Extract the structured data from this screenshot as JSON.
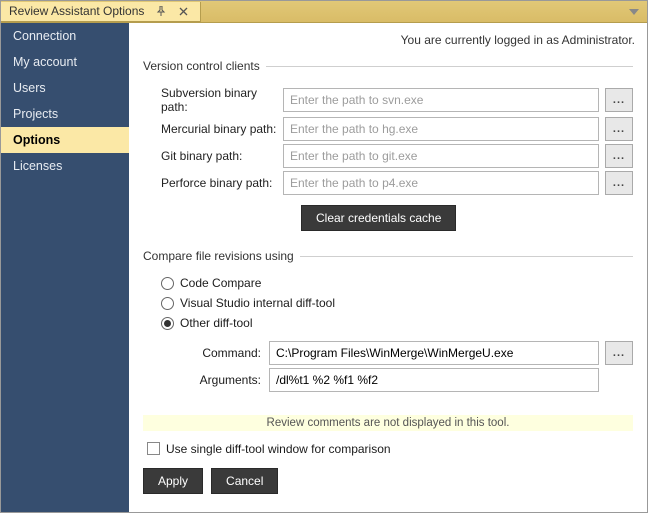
{
  "window": {
    "title": "Review Assistant Options"
  },
  "sidebar": {
    "items": [
      {
        "label": "Connection"
      },
      {
        "label": "My account"
      },
      {
        "label": "Users"
      },
      {
        "label": "Projects"
      },
      {
        "label": "Options"
      },
      {
        "label": "Licenses"
      }
    ],
    "activeIndex": 4
  },
  "status": {
    "text": "You are currently logged in as Administrator."
  },
  "vcs": {
    "legend": "Version control clients",
    "svn": {
      "label": "Subversion binary path:",
      "placeholder": "Enter the path to svn.exe",
      "value": ""
    },
    "hg": {
      "label": "Mercurial binary path:",
      "placeholder": "Enter the path to hg.exe",
      "value": ""
    },
    "git": {
      "label": "Git binary path:",
      "placeholder": "Enter the path to git.exe",
      "value": ""
    },
    "p4": {
      "label": "Perforce binary path:",
      "placeholder": "Enter the path to p4.exe",
      "value": ""
    },
    "clear_label": "Clear credentials cache",
    "browse": "..."
  },
  "compare": {
    "legend": "Compare file revisions using",
    "opt_cc": "Code Compare",
    "opt_vs": "Visual Studio internal diff-tool",
    "opt_other": "Other diff-tool",
    "selected": "other",
    "cmd_label": "Command:",
    "cmd_value": "C:\\Program Files\\WinMerge\\WinMergeU.exe",
    "args_label": "Arguments:",
    "args_value": "/dl%t1 %2 %f1 %f2",
    "browse": "..."
  },
  "warning": {
    "text": "Review comments are not displayed in this tool."
  },
  "single": {
    "label": "Use single diff-tool window for comparison",
    "checked": false
  },
  "footer": {
    "apply": "Apply",
    "cancel": "Cancel"
  }
}
